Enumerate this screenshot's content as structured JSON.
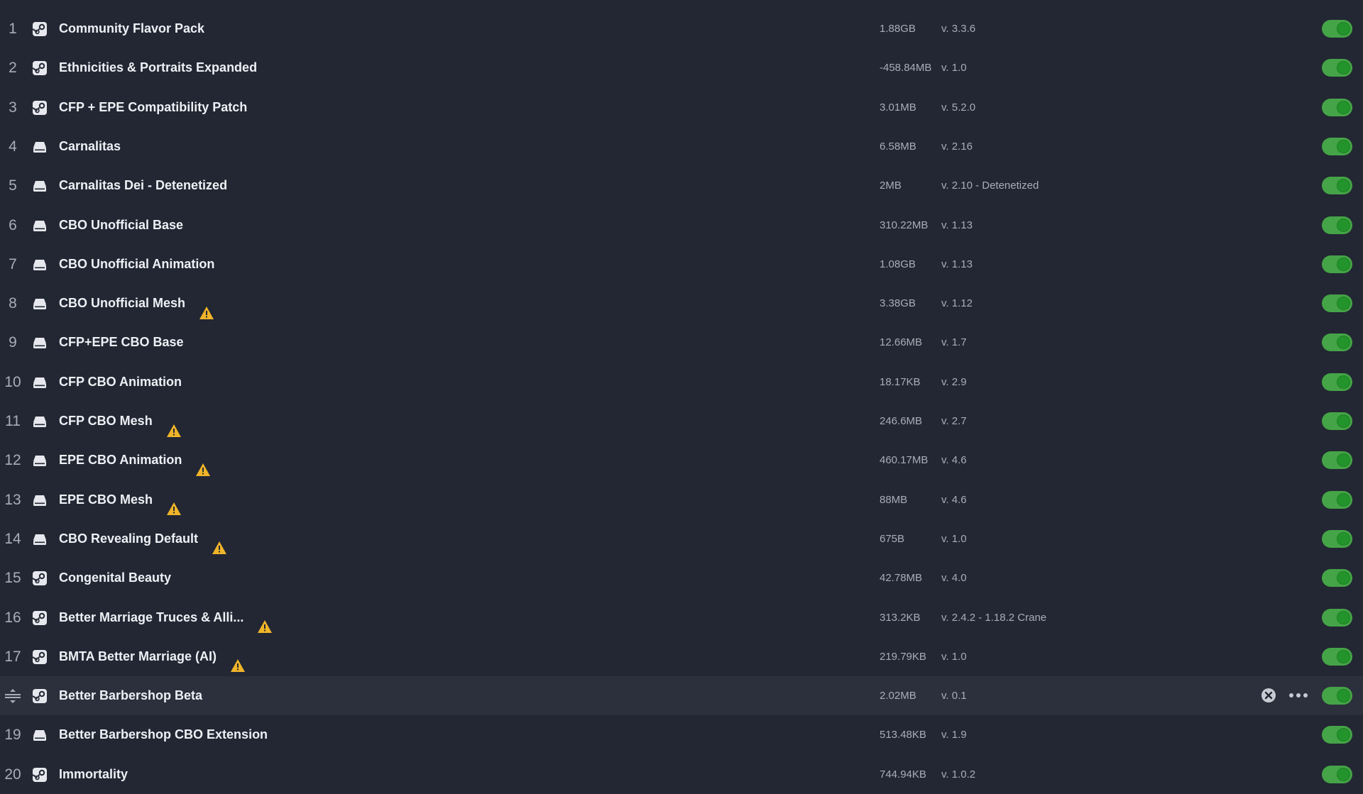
{
  "mods": [
    {
      "index": "1",
      "source": "steam",
      "name": "Community Flavor Pack",
      "warning": false,
      "size": "1.88GB",
      "version": "v. 3.3.6",
      "enabled": true
    },
    {
      "index": "2",
      "source": "steam",
      "name": "Ethnicities & Portraits Expanded",
      "warning": false,
      "size": "-458.84MB",
      "version": "v. 1.0",
      "enabled": true
    },
    {
      "index": "3",
      "source": "steam",
      "name": "CFP + EPE Compatibility Patch",
      "warning": false,
      "size": "3.01MB",
      "version": "v. 5.2.0",
      "enabled": true
    },
    {
      "index": "4",
      "source": "local",
      "name": "Carnalitas",
      "warning": false,
      "size": "6.58MB",
      "version": "v. 2.16",
      "enabled": true
    },
    {
      "index": "5",
      "source": "local",
      "name": "Carnalitas Dei - Detenetized",
      "warning": false,
      "size": "2MB",
      "version": "v. 2.10 - Detenetized",
      "enabled": true
    },
    {
      "index": "6",
      "source": "local",
      "name": "CBO Unofficial Base",
      "warning": false,
      "size": "310.22MB",
      "version": "v. 1.13",
      "enabled": true
    },
    {
      "index": "7",
      "source": "local",
      "name": "CBO Unofficial Animation",
      "warning": false,
      "size": "1.08GB",
      "version": "v. 1.13",
      "enabled": true
    },
    {
      "index": "8",
      "source": "local",
      "name": "CBO Unofficial Mesh",
      "warning": true,
      "size": "3.38GB",
      "version": "v. 1.12",
      "enabled": true
    },
    {
      "index": "9",
      "source": "local",
      "name": "CFP+EPE CBO Base",
      "warning": false,
      "size": "12.66MB",
      "version": "v. 1.7",
      "enabled": true
    },
    {
      "index": "10",
      "source": "local",
      "name": "CFP CBO Animation",
      "warning": false,
      "size": "18.17KB",
      "version": "v. 2.9",
      "enabled": true
    },
    {
      "index": "11",
      "source": "local",
      "name": "CFP CBO Mesh",
      "warning": true,
      "size": "246.6MB",
      "version": "v. 2.7",
      "enabled": true
    },
    {
      "index": "12",
      "source": "local",
      "name": "EPE CBO Animation",
      "warning": true,
      "size": "460.17MB",
      "version": "v. 4.6",
      "enabled": true
    },
    {
      "index": "13",
      "source": "local",
      "name": "EPE CBO Mesh",
      "warning": true,
      "size": "88MB",
      "version": "v. 4.6",
      "enabled": true
    },
    {
      "index": "14",
      "source": "local",
      "name": "CBO Revealing Default",
      "warning": true,
      "size": "675B",
      "version": "v. 1.0",
      "enabled": true
    },
    {
      "index": "15",
      "source": "steam",
      "name": "Congenital Beauty",
      "warning": false,
      "size": "42.78MB",
      "version": "v. 4.0",
      "enabled": true
    },
    {
      "index": "16",
      "source": "steam",
      "name": "Better Marriage Truces & Alli...",
      "warning": true,
      "size": "313.2KB",
      "version": "v. 2.4.2 - 1.18.2 Crane",
      "enabled": true
    },
    {
      "index": "17",
      "source": "steam",
      "name": "BMTA Better Marriage (AI)",
      "warning": true,
      "size": "219.79KB",
      "version": "v. 1.0",
      "enabled": true
    },
    {
      "index": "",
      "source": "steam",
      "name": "Better Barbershop Beta",
      "warning": false,
      "size": "2.02MB",
      "version": "v. 0.1",
      "enabled": true,
      "hovered": true
    },
    {
      "index": "19",
      "source": "local",
      "name": "Better Barbershop CBO Extension",
      "warning": false,
      "size": "513.48KB",
      "version": "v. 1.9",
      "enabled": true
    },
    {
      "index": "20",
      "source": "steam",
      "name": "Immortality",
      "warning": false,
      "size": "744.94KB",
      "version": "v. 1.0.2",
      "enabled": true
    }
  ],
  "icons": {
    "steam": "steam-icon",
    "local": "local-drive-icon",
    "warning": "warning-icon",
    "drag": "drag-handle-icon",
    "remove": "remove-icon",
    "more": "more-options-icon"
  },
  "colors": {
    "background": "#232733",
    "row_hover": "#2c303c",
    "toggle_on": "#45a447",
    "warning": "#f0b429",
    "text_primary": "#eef0f5",
    "text_secondary": "#a9adb8"
  }
}
